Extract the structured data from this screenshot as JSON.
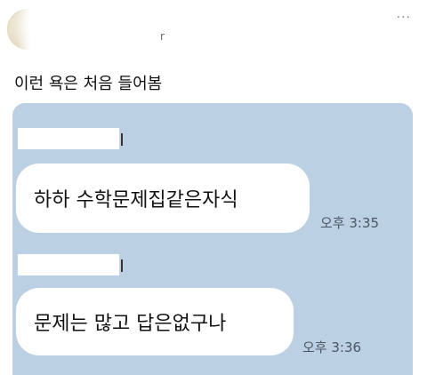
{
  "post": {
    "menu_glyph": "···",
    "name_tail": "r",
    "text": "이런 욕은 처음 들어봄"
  },
  "chat": {
    "messages": [
      {
        "text": "하하 수학문제집같은자식",
        "time": "오후 3:35"
      },
      {
        "text": "문제는 많고 답은없구나",
        "time": "오후 3:36"
      }
    ]
  },
  "colors": {
    "chat_background": "#bcd0e3",
    "bubble": "#ffffff"
  }
}
